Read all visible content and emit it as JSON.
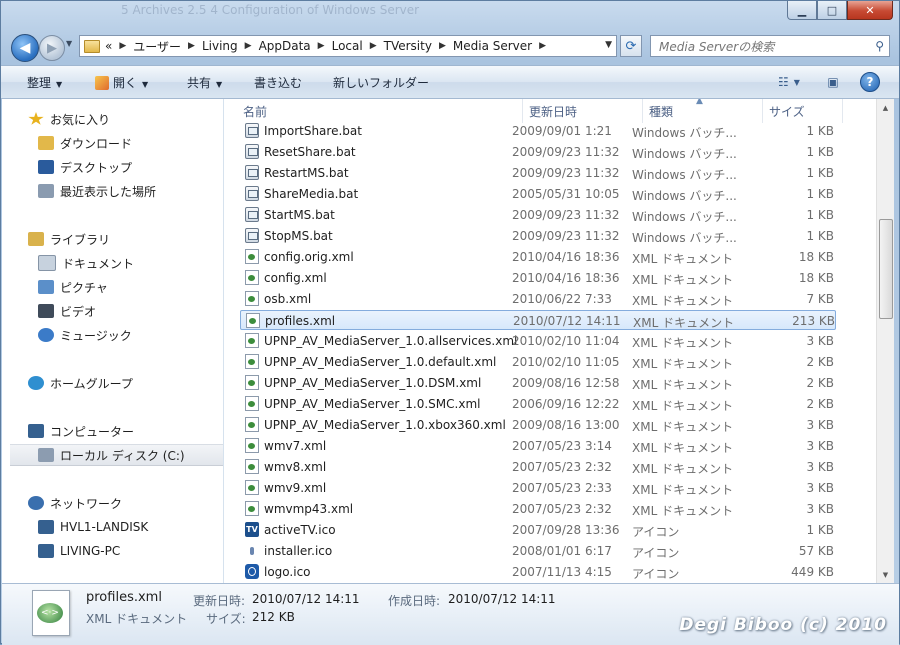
{
  "title_blur": "5  Archives                                   2.5 4   Configuration of Windows Server",
  "nav": {
    "breadcrumbs": [
      "«",
      "ユーザー",
      "Living",
      "AppData",
      "Local",
      "TVersity",
      "Media Server"
    ],
    "search_placeholder": "Media Serverの検索"
  },
  "toolbar": {
    "organize": "整理",
    "open": "開く",
    "share": "共有",
    "burn": "書き込む",
    "new_folder": "新しいフォルダー"
  },
  "sidebar": {
    "items": [
      {
        "label": "お気に入り",
        "icon": "star-icon",
        "color": "#e8b21e"
      },
      {
        "label": "ダウンロード",
        "icon": "download-folder-icon",
        "color": "#e2b84a"
      },
      {
        "label": "デスクトップ",
        "icon": "desktop-icon",
        "color": "#2a5b9c"
      },
      {
        "label": "最近表示した場所",
        "icon": "recent-places-icon",
        "color": "#8a9bb0"
      },
      {
        "label": "ライブラリ",
        "icon": "libraries-icon",
        "color": "#d9b24c"
      },
      {
        "label": "ドキュメント",
        "icon": "documents-icon",
        "color": "#c7d2de"
      },
      {
        "label": "ピクチャ",
        "icon": "pictures-icon",
        "color": "#5b8fc9"
      },
      {
        "label": "ビデオ",
        "icon": "videos-icon",
        "color": "#3f4b5a"
      },
      {
        "label": "ミュージック",
        "icon": "music-icon",
        "color": "#3b7bc8"
      },
      {
        "label": "ホームグループ",
        "icon": "homegroup-icon",
        "color": "#2f8fd0"
      },
      {
        "label": "コンピューター",
        "icon": "computer-icon",
        "color": "#35608f"
      },
      {
        "label": "ローカル ディスク (C:)",
        "icon": "local-disk-icon",
        "color": "#8c9cb0"
      },
      {
        "label": "ネットワーク",
        "icon": "network-icon",
        "color": "#3a6fae"
      },
      {
        "label": "HVL1-LANDISK",
        "icon": "network-computer-icon",
        "color": "#35608f"
      },
      {
        "label": "LIVING-PC",
        "icon": "network-computer-icon",
        "color": "#35608f"
      }
    ]
  },
  "columns": {
    "name": "名前",
    "date": "更新日時",
    "type": "種類",
    "size": "サイズ"
  },
  "files": [
    {
      "name": "ImportShare.bat",
      "date": "2009/09/01 1:21",
      "type": "Windows バッチ...",
      "size": "1 KB",
      "icon": "bat"
    },
    {
      "name": "ResetShare.bat",
      "date": "2009/09/23 11:32",
      "type": "Windows バッチ...",
      "size": "1 KB",
      "icon": "bat"
    },
    {
      "name": "RestartMS.bat",
      "date": "2009/09/23 11:32",
      "type": "Windows バッチ...",
      "size": "1 KB",
      "icon": "bat"
    },
    {
      "name": "ShareMedia.bat",
      "date": "2005/05/31 10:05",
      "type": "Windows バッチ...",
      "size": "1 KB",
      "icon": "bat"
    },
    {
      "name": "StartMS.bat",
      "date": "2009/09/23 11:32",
      "type": "Windows バッチ...",
      "size": "1 KB",
      "icon": "bat"
    },
    {
      "name": "StopMS.bat",
      "date": "2009/09/23 11:32",
      "type": "Windows バッチ...",
      "size": "1 KB",
      "icon": "bat"
    },
    {
      "name": "config.orig.xml",
      "date": "2010/04/16 18:36",
      "type": "XML ドキュメント",
      "size": "18 KB",
      "icon": "xml"
    },
    {
      "name": "config.xml",
      "date": "2010/04/16 18:36",
      "type": "XML ドキュメント",
      "size": "18 KB",
      "icon": "xml"
    },
    {
      "name": "osb.xml",
      "date": "2010/06/22 7:33",
      "type": "XML ドキュメント",
      "size": "7 KB",
      "icon": "xml"
    },
    {
      "name": "profiles.xml",
      "date": "2010/07/12 14:11",
      "type": "XML ドキュメント",
      "size": "213 KB",
      "icon": "xml",
      "selected": true
    },
    {
      "name": "UPNP_AV_MediaServer_1.0.allservices.xml",
      "date": "2010/02/10 11:04",
      "type": "XML ドキュメント",
      "size": "3 KB",
      "icon": "xml"
    },
    {
      "name": "UPNP_AV_MediaServer_1.0.default.xml",
      "date": "2010/02/10 11:05",
      "type": "XML ドキュメント",
      "size": "2 KB",
      "icon": "xml"
    },
    {
      "name": "UPNP_AV_MediaServer_1.0.DSM.xml",
      "date": "2009/08/16 12:58",
      "type": "XML ドキュメント",
      "size": "2 KB",
      "icon": "xml"
    },
    {
      "name": "UPNP_AV_MediaServer_1.0.SMC.xml",
      "date": "2006/09/16 12:22",
      "type": "XML ドキュメント",
      "size": "2 KB",
      "icon": "xml"
    },
    {
      "name": "UPNP_AV_MediaServer_1.0.xbox360.xml",
      "date": "2009/08/16 13:00",
      "type": "XML ドキュメント",
      "size": "3 KB",
      "icon": "xml"
    },
    {
      "name": "wmv7.xml",
      "date": "2007/05/23 3:14",
      "type": "XML ドキュメント",
      "size": "3 KB",
      "icon": "xml"
    },
    {
      "name": "wmv8.xml",
      "date": "2007/05/23 2:32",
      "type": "XML ドキュメント",
      "size": "3 KB",
      "icon": "xml"
    },
    {
      "name": "wmv9.xml",
      "date": "2007/05/23 2:33",
      "type": "XML ドキュメント",
      "size": "3 KB",
      "icon": "xml"
    },
    {
      "name": "wmvmp43.xml",
      "date": "2007/05/23 2:32",
      "type": "XML ドキュメント",
      "size": "3 KB",
      "icon": "xml"
    },
    {
      "name": "activeTV.ico",
      "date": "2007/09/28 13:36",
      "type": "アイコン",
      "size": "1 KB",
      "icon": "ico-tv"
    },
    {
      "name": "installer.ico",
      "date": "2008/01/01 6:17",
      "type": "アイコン",
      "size": "57 KB",
      "icon": "ico-inst"
    },
    {
      "name": "logo.ico",
      "date": "2007/11/13 4:15",
      "type": "アイコン",
      "size": "449 KB",
      "icon": "ico-logo"
    }
  ],
  "details": {
    "filename": "profiles.xml",
    "type": "XML ドキュメント",
    "modified_label": "更新日時:",
    "modified_value": "2010/07/12 14:11",
    "created_label": "作成日時:",
    "created_value": "2010/07/12 14:11",
    "size_label": "サイズ:",
    "size_value": "212 KB"
  },
  "watermark": "Degi Biboo (c) 2010"
}
